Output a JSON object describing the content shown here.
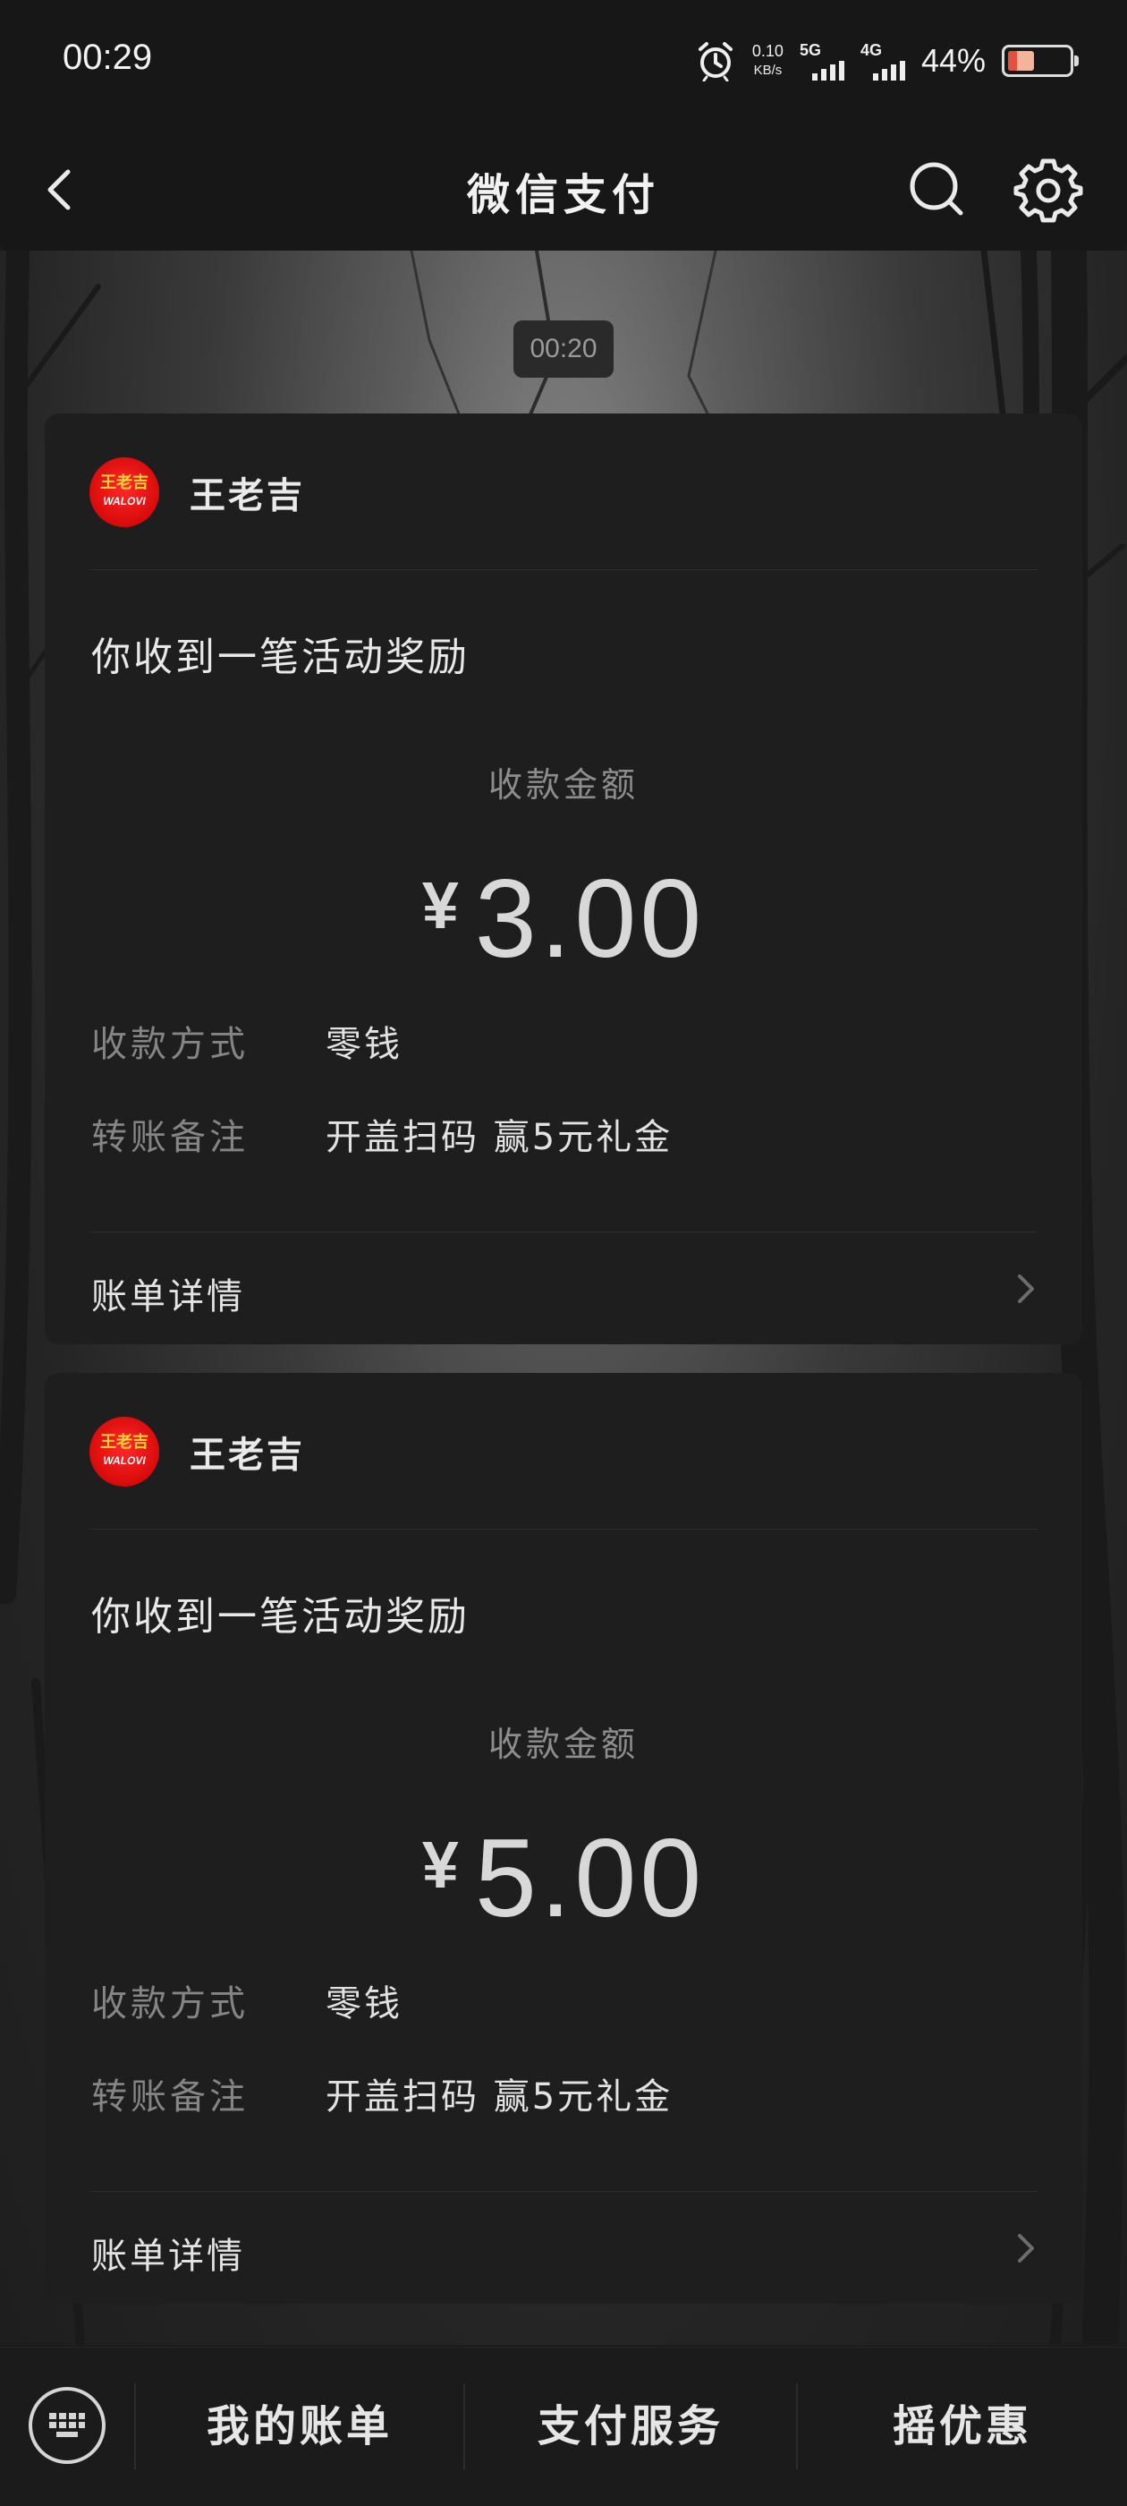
{
  "status_bar": {
    "time": "00:29",
    "net_speed_value": "0.10",
    "net_speed_unit": "KB/s",
    "signal1_label": "5G",
    "signal2_label": "4G",
    "battery_percent": "44%",
    "battery_level": 0.44,
    "icons": [
      "alarm-icon",
      "signal-icon",
      "battery-icon"
    ]
  },
  "nav": {
    "title": "微信支付",
    "back_icon": "chevron-left-icon",
    "search_icon": "search-icon",
    "settings_icon": "gear-icon"
  },
  "timestamp": "00:20",
  "cards": [
    {
      "brand": "王老吉",
      "logo_cn": "王老吉",
      "logo_en": "WALOVI",
      "title": "你收到一笔活动奖励",
      "amount_label": "收款金额",
      "currency": "¥",
      "amount": "3.00",
      "rows": [
        {
          "key": "收款方式",
          "value": "零钱"
        },
        {
          "key": "转账备注",
          "value": "开盖扫码 赢5元礼金"
        }
      ],
      "footer": "账单详情"
    },
    {
      "brand": "王老吉",
      "logo_cn": "王老吉",
      "logo_en": "WALOVI",
      "title": "你收到一笔活动奖励",
      "amount_label": "收款金额",
      "currency": "¥",
      "amount": "5.00",
      "rows": [
        {
          "key": "收款方式",
          "value": "零钱"
        },
        {
          "key": "转账备注",
          "value": "开盖扫码 赢5元礼金"
        }
      ],
      "footer": "账单详情"
    }
  ],
  "bottom_bar": {
    "keyboard_icon": "keyboard-icon",
    "tabs": [
      "我的账单",
      "支付服务",
      "摇优惠"
    ]
  },
  "colors": {
    "background": "#1b1b1b",
    "card": "#1e1e1e",
    "logo_red": "#d80a0a"
  }
}
